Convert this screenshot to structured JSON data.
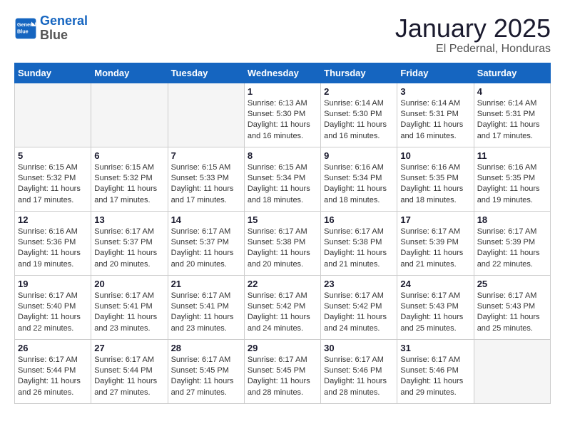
{
  "header": {
    "logo_line1": "General",
    "logo_line2": "Blue",
    "month": "January 2025",
    "location": "El Pedernal, Honduras"
  },
  "weekdays": [
    "Sunday",
    "Monday",
    "Tuesday",
    "Wednesday",
    "Thursday",
    "Friday",
    "Saturday"
  ],
  "weeks": [
    [
      {
        "day": "",
        "empty": true
      },
      {
        "day": "",
        "empty": true
      },
      {
        "day": "",
        "empty": true
      },
      {
        "day": "1",
        "sunrise": "6:13 AM",
        "sunset": "5:30 PM",
        "daylight": "11 hours and 16 minutes."
      },
      {
        "day": "2",
        "sunrise": "6:14 AM",
        "sunset": "5:30 PM",
        "daylight": "11 hours and 16 minutes."
      },
      {
        "day": "3",
        "sunrise": "6:14 AM",
        "sunset": "5:31 PM",
        "daylight": "11 hours and 16 minutes."
      },
      {
        "day": "4",
        "sunrise": "6:14 AM",
        "sunset": "5:31 PM",
        "daylight": "11 hours and 17 minutes."
      }
    ],
    [
      {
        "day": "5",
        "sunrise": "6:15 AM",
        "sunset": "5:32 PM",
        "daylight": "11 hours and 17 minutes."
      },
      {
        "day": "6",
        "sunrise": "6:15 AM",
        "sunset": "5:32 PM",
        "daylight": "11 hours and 17 minutes."
      },
      {
        "day": "7",
        "sunrise": "6:15 AM",
        "sunset": "5:33 PM",
        "daylight": "11 hours and 17 minutes."
      },
      {
        "day": "8",
        "sunrise": "6:15 AM",
        "sunset": "5:34 PM",
        "daylight": "11 hours and 18 minutes."
      },
      {
        "day": "9",
        "sunrise": "6:16 AM",
        "sunset": "5:34 PM",
        "daylight": "11 hours and 18 minutes."
      },
      {
        "day": "10",
        "sunrise": "6:16 AM",
        "sunset": "5:35 PM",
        "daylight": "11 hours and 18 minutes."
      },
      {
        "day": "11",
        "sunrise": "6:16 AM",
        "sunset": "5:35 PM",
        "daylight": "11 hours and 19 minutes."
      }
    ],
    [
      {
        "day": "12",
        "sunrise": "6:16 AM",
        "sunset": "5:36 PM",
        "daylight": "11 hours and 19 minutes."
      },
      {
        "day": "13",
        "sunrise": "6:17 AM",
        "sunset": "5:37 PM",
        "daylight": "11 hours and 20 minutes."
      },
      {
        "day": "14",
        "sunrise": "6:17 AM",
        "sunset": "5:37 PM",
        "daylight": "11 hours and 20 minutes."
      },
      {
        "day": "15",
        "sunrise": "6:17 AM",
        "sunset": "5:38 PM",
        "daylight": "11 hours and 20 minutes."
      },
      {
        "day": "16",
        "sunrise": "6:17 AM",
        "sunset": "5:38 PM",
        "daylight": "11 hours and 21 minutes."
      },
      {
        "day": "17",
        "sunrise": "6:17 AM",
        "sunset": "5:39 PM",
        "daylight": "11 hours and 21 minutes."
      },
      {
        "day": "18",
        "sunrise": "6:17 AM",
        "sunset": "5:39 PM",
        "daylight": "11 hours and 22 minutes."
      }
    ],
    [
      {
        "day": "19",
        "sunrise": "6:17 AM",
        "sunset": "5:40 PM",
        "daylight": "11 hours and 22 minutes."
      },
      {
        "day": "20",
        "sunrise": "6:17 AM",
        "sunset": "5:41 PM",
        "daylight": "11 hours and 23 minutes."
      },
      {
        "day": "21",
        "sunrise": "6:17 AM",
        "sunset": "5:41 PM",
        "daylight": "11 hours and 23 minutes."
      },
      {
        "day": "22",
        "sunrise": "6:17 AM",
        "sunset": "5:42 PM",
        "daylight": "11 hours and 24 minutes."
      },
      {
        "day": "23",
        "sunrise": "6:17 AM",
        "sunset": "5:42 PM",
        "daylight": "11 hours and 24 minutes."
      },
      {
        "day": "24",
        "sunrise": "6:17 AM",
        "sunset": "5:43 PM",
        "daylight": "11 hours and 25 minutes."
      },
      {
        "day": "25",
        "sunrise": "6:17 AM",
        "sunset": "5:43 PM",
        "daylight": "11 hours and 25 minutes."
      }
    ],
    [
      {
        "day": "26",
        "sunrise": "6:17 AM",
        "sunset": "5:44 PM",
        "daylight": "11 hours and 26 minutes."
      },
      {
        "day": "27",
        "sunrise": "6:17 AM",
        "sunset": "5:44 PM",
        "daylight": "11 hours and 27 minutes."
      },
      {
        "day": "28",
        "sunrise": "6:17 AM",
        "sunset": "5:45 PM",
        "daylight": "11 hours and 27 minutes."
      },
      {
        "day": "29",
        "sunrise": "6:17 AM",
        "sunset": "5:45 PM",
        "daylight": "11 hours and 28 minutes."
      },
      {
        "day": "30",
        "sunrise": "6:17 AM",
        "sunset": "5:46 PM",
        "daylight": "11 hours and 28 minutes."
      },
      {
        "day": "31",
        "sunrise": "6:17 AM",
        "sunset": "5:46 PM",
        "daylight": "11 hours and 29 minutes."
      },
      {
        "day": "",
        "empty": true
      }
    ]
  ]
}
